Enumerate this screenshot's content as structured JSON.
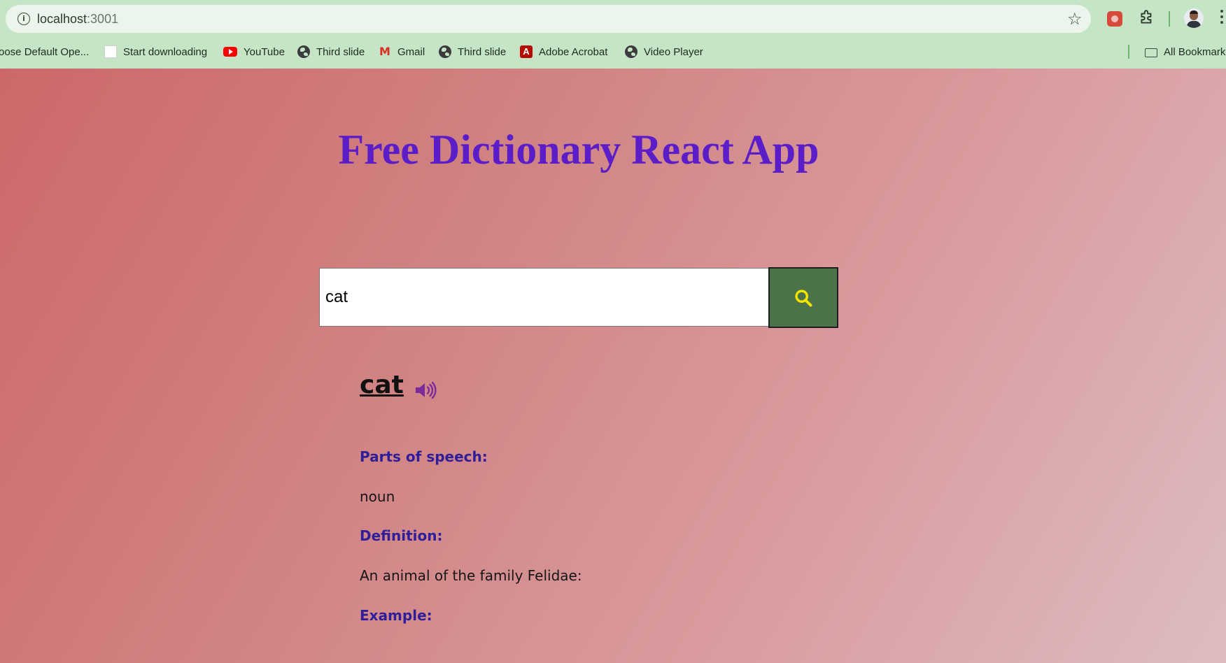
{
  "browser": {
    "url_host": "localhost",
    "url_port": ":3001",
    "bookmarks": [
      {
        "label": "oose Default Ope...",
        "icon": "none"
      },
      {
        "label": "Start downloading",
        "icon": "blank-page-icon"
      },
      {
        "label": "YouTube",
        "icon": "youtube-icon"
      },
      {
        "label": "Third slide",
        "icon": "globe-icon"
      },
      {
        "label": "Gmail",
        "icon": "gmail-icon"
      },
      {
        "label": "Third slide",
        "icon": "globe-icon"
      },
      {
        "label": "Adobe Acrobat",
        "icon": "acrobat-icon"
      },
      {
        "label": "Video Player",
        "icon": "globe-icon"
      }
    ],
    "all_bookmarks_label": "All Bookmarks"
  },
  "app": {
    "title": "Free Dictionary React App",
    "search": {
      "value": "cat",
      "button_icon": "search-icon"
    },
    "result": {
      "word": "cat",
      "parts_of_speech_label": "Parts of speech:",
      "parts_of_speech_value": "noun",
      "definition_label": "Definition:",
      "definition_value": "An animal of the family Felidae:",
      "example_label": "Example:"
    }
  },
  "colors": {
    "chrome_bg": "#c6e4c6",
    "title": "#5a1dc7",
    "label": "#2f1e9a",
    "search_button": "#4b7249",
    "search_icon": "#f5e400",
    "speaker_icon": "#7a2a9a"
  }
}
